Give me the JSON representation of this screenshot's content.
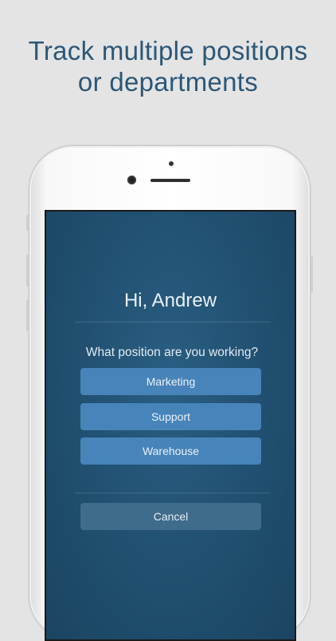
{
  "headline": {
    "line1": "Track multiple positions",
    "line2": "or departments"
  },
  "screen": {
    "greeting": "Hi, Andrew",
    "question": "What position are you working?",
    "positions": [
      {
        "label": "Marketing"
      },
      {
        "label": "Support"
      },
      {
        "label": "Warehouse"
      }
    ],
    "cancel_label": "Cancel"
  },
  "colors": {
    "background": "#e4e4e4",
    "headline": "#2b5778",
    "screen": "#204f70",
    "button": "#4684b9",
    "cancel_button": "#3f6b8c"
  }
}
